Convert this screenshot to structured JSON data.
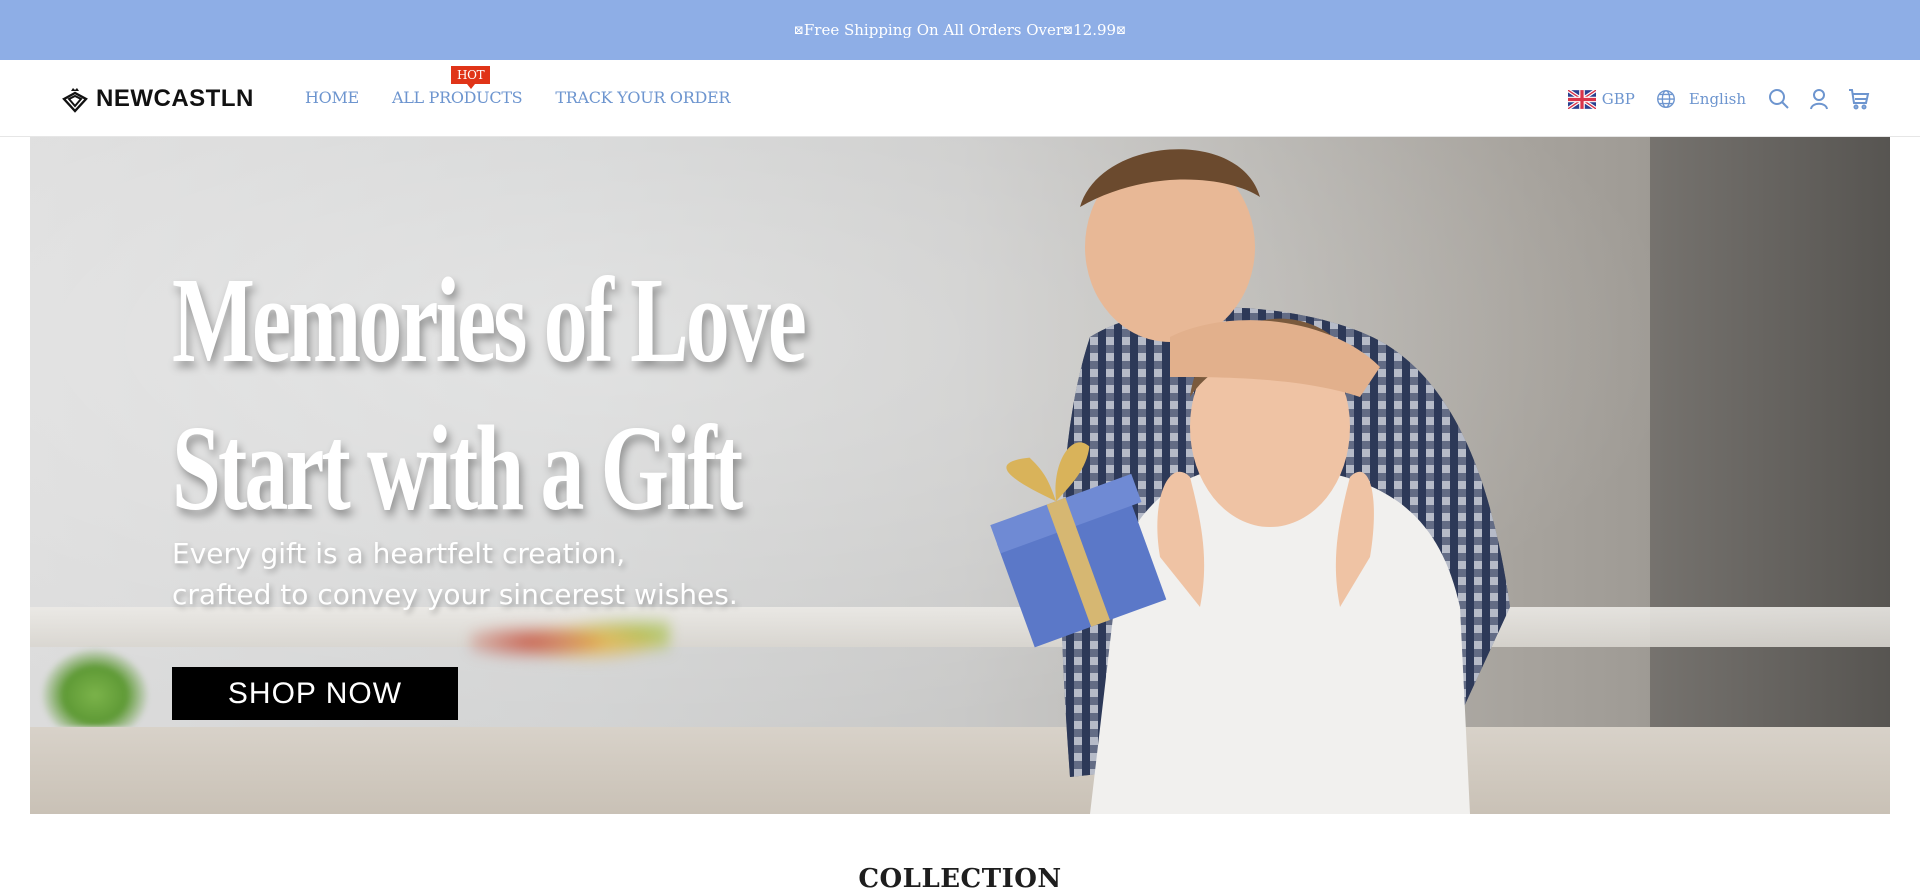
{
  "announcement": {
    "box_glyph": "⊠",
    "text": "Free Shipping On All Orders Over ",
    "amount": "12.99"
  },
  "header": {
    "logo_text": "NEWCASTLN",
    "nav": [
      {
        "label": "HOME"
      },
      {
        "label": "ALL PRODUCTS",
        "badge": "HOT"
      },
      {
        "label": "TRACK YOUR ORDER"
      }
    ],
    "currency": "GBP",
    "language": "English",
    "icons": [
      "uk-flag-icon",
      "globe-icon",
      "search-icon",
      "account-icon",
      "cart-icon"
    ]
  },
  "hero": {
    "title_line1": "Memories of Love",
    "title_line2": "Start with a Gift",
    "subtitle_line1": "Every gift is a heartfelt creation,",
    "subtitle_line2": "crafted to convey your sincerest wishes.",
    "cta_label": "SHOP NOW"
  },
  "sections": {
    "collection_title": "COLLECTION"
  },
  "colors": {
    "announcement_bg": "#8eaee6",
    "nav_link": "#6d95cf",
    "hot_badge": "#e03418",
    "cta_bg": "#000000"
  }
}
